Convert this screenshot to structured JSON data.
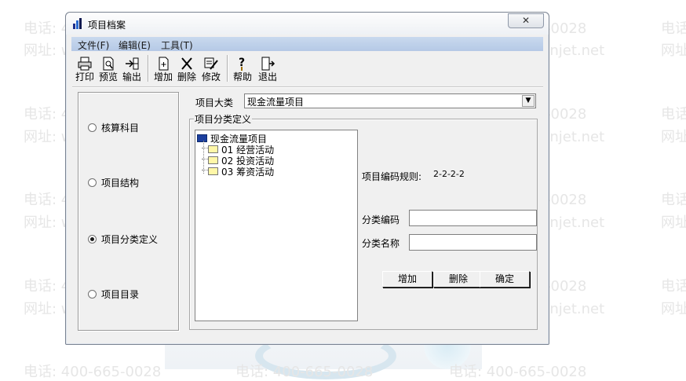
{
  "window": {
    "title": "项目档案",
    "close_symbol": "✕"
  },
  "menu": [
    "文件(F)",
    "编辑(E)",
    "工具(T)"
  ],
  "toolbar": {
    "print": "打印",
    "preview": "预览",
    "export": "输出",
    "add": "增加",
    "delete": "删除",
    "modify": "修改",
    "help": "帮助",
    "exit": "退出"
  },
  "left_panel": {
    "options": [
      "核算科目",
      "项目结构",
      "项目分类定义",
      "项目目录"
    ],
    "selected": "项目分类定义"
  },
  "category": {
    "label": "项目大类",
    "value": "现金流量项目"
  },
  "group": {
    "legend": "项目分类定义"
  },
  "tree": {
    "root": "现金流量项目",
    "children": [
      "01 经营活动",
      "02 投资活动",
      "03 筹资活动"
    ]
  },
  "form": {
    "code_rule_label": "项目编码规则:",
    "code_rule_value": "2-2-2-2",
    "class_code_label": "分类编码",
    "class_code_value": "",
    "class_name_label": "分类名称",
    "class_name_value": ""
  },
  "buttons": {
    "add": "增加",
    "delete": "删除",
    "ok": "确定"
  },
  "watermark": {
    "phone": "电话: 400-665-0028",
    "site": "网址: www.chanjet.net"
  },
  "colors": {
    "menubar": "#b5c9e6",
    "tree_root_icon": "#1c3f9e",
    "folder_icon": "#fff7a8"
  }
}
